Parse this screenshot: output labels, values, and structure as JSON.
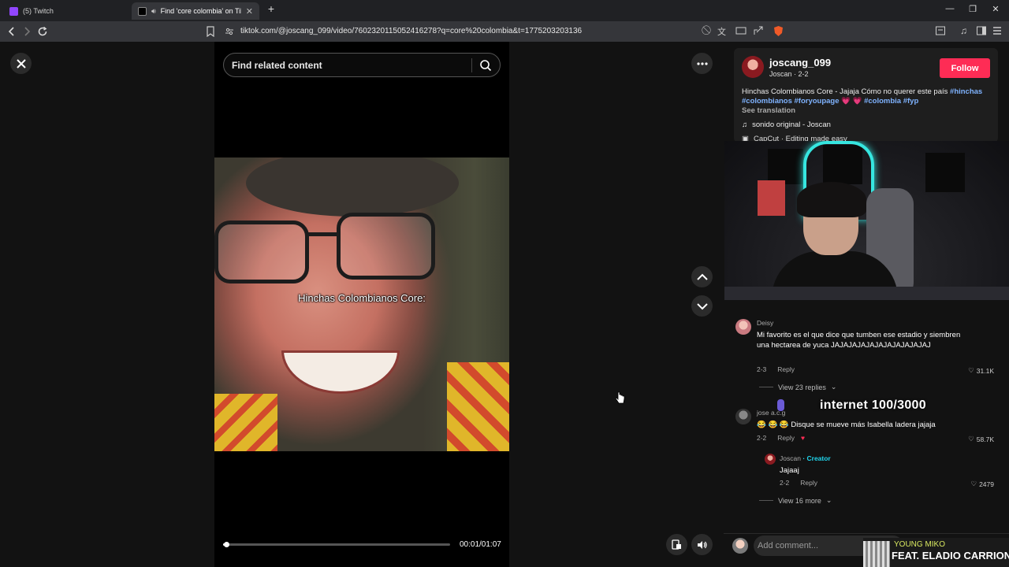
{
  "browser": {
    "tabs": [
      {
        "title": "(5) Twitch",
        "favicon_color": "#9146ff",
        "active": false
      },
      {
        "title": "Find 'core colombia' on TikTo",
        "favicon_color": "#000000",
        "active": true
      }
    ],
    "url": "tiktok.com/@joscang_099/video/7602320115052416278?q=core%20colombia&t=1775203203136"
  },
  "search": {
    "placeholder": "Find related content"
  },
  "video": {
    "caption": "Hinchas Colombianos Core:",
    "current_time": "00:01",
    "duration": "01:07",
    "timecode": "00:01/01:07",
    "progress": 0.015
  },
  "post": {
    "username": "joscang_099",
    "subline": "Joscan · 2-2",
    "follow_label": "Follow",
    "description_text": "Hinchas Colombianos Core - Jajaja Cómo no querer este país ",
    "hashtags_line1": "#hinchas",
    "hashtags_line2": "#colombianos #foryoupage",
    "hearts": "💗 💗",
    "hashtags_line3": "#colombia #fyp",
    "see_translation": "See translation",
    "music": "sonido original - Joscan",
    "capcut": "CapCut · Editing made easy"
  },
  "comments": [
    {
      "author": "Deisy",
      "text": "Mi favorito es el que dice que tumben ese estadio y siembren una hectarea de yuca JAJAJAJAJAJAJAJAJAJAJAJ",
      "date": "2-3",
      "reply": "Reply",
      "likes": "31.1K",
      "view_replies": "View 23 replies"
    },
    {
      "author": "jose a.c.g",
      "text": "😂 😂 😂  Disque se mueve más Isabella ladera jajaja",
      "date": "2-2",
      "reply": "Reply",
      "likes": "58.7K"
    },
    {
      "author": "Joscan",
      "creator_badge": "· Creator",
      "text": "Jajaaj",
      "date": "2-2",
      "reply": "Reply",
      "likes": "2479",
      "view_more": "View 16 more"
    }
  ],
  "stream_overlay": {
    "text": "internet 100/3000",
    "song_artist": "YOUNG MIKO",
    "song_title": "FEAT. ELADIO CARRION"
  },
  "add_comment": {
    "placeholder": "Add comment..."
  },
  "colors": {
    "accent": "#fe2c55",
    "hashtag": "#7fb3ff",
    "creator": "#20d5ec"
  }
}
